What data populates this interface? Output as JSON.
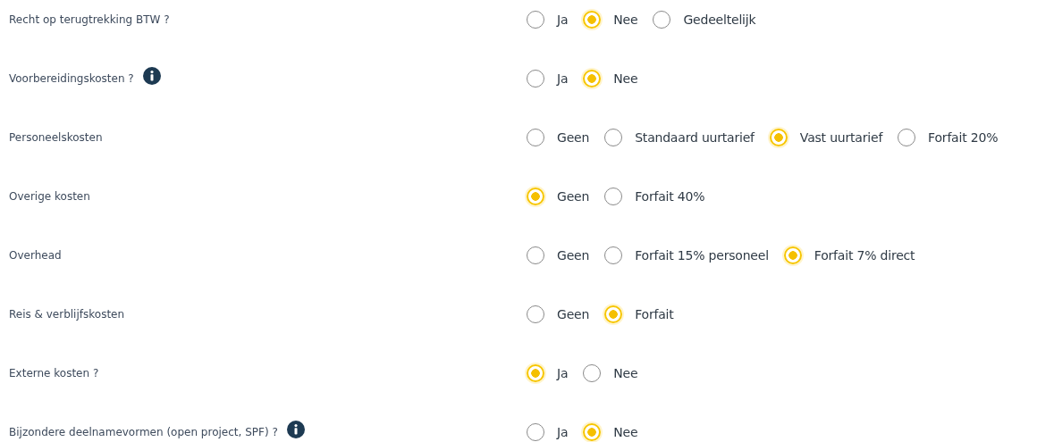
{
  "questions": [
    {
      "label": "Recht op terugtrekking BTW ?",
      "info": false,
      "options": [
        {
          "label": "Ja",
          "selected": false
        },
        {
          "label": "Nee",
          "selected": true
        },
        {
          "label": "Gedeeltelijk",
          "selected": false
        }
      ]
    },
    {
      "label": "Voorbereidingskosten ?",
      "info": true,
      "options": [
        {
          "label": "Ja",
          "selected": false
        },
        {
          "label": "Nee",
          "selected": true
        }
      ]
    },
    {
      "label": "Personeelskosten",
      "info": false,
      "options": [
        {
          "label": "Geen",
          "selected": false
        },
        {
          "label": "Standaard uurtarief",
          "selected": false
        },
        {
          "label": "Vast uurtarief",
          "selected": true
        },
        {
          "label": "Forfait 20%",
          "selected": false
        }
      ]
    },
    {
      "label": "Overige kosten",
      "info": false,
      "options": [
        {
          "label": "Geen",
          "selected": true
        },
        {
          "label": "Forfait 40%",
          "selected": false
        }
      ]
    },
    {
      "label": "Overhead",
      "info": false,
      "options": [
        {
          "label": "Geen",
          "selected": false
        },
        {
          "label": "Forfait 15% personeel",
          "selected": false
        },
        {
          "label": "Forfait 7% direct",
          "selected": true
        }
      ]
    },
    {
      "label": "Reis & verblijfskosten",
      "info": false,
      "options": [
        {
          "label": "Geen",
          "selected": false
        },
        {
          "label": "Forfait",
          "selected": true
        }
      ]
    },
    {
      "label": "Externe kosten ?",
      "info": false,
      "options": [
        {
          "label": "Ja",
          "selected": true
        },
        {
          "label": "Nee",
          "selected": false
        }
      ]
    },
    {
      "label": "Bijzondere deelnamevormen (open project, SPF) ?",
      "info": true,
      "options": [
        {
          "label": "Ja",
          "selected": false
        },
        {
          "label": "Nee",
          "selected": true
        }
      ]
    }
  ]
}
